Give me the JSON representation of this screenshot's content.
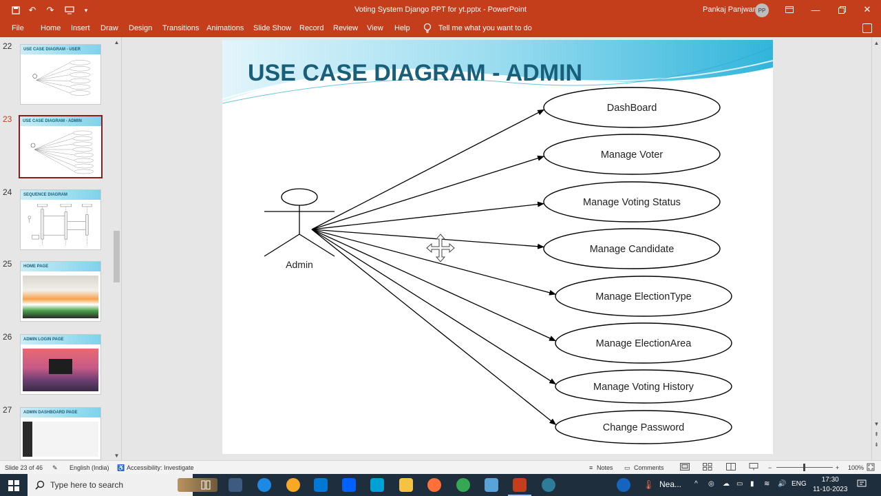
{
  "window": {
    "title": "Voting System Django PPT for yt.pptx  -  PowerPoint",
    "user_name": "Pankaj Panjwani",
    "user_initials": "PP",
    "qa_icons": [
      "save-icon",
      "undo-icon",
      "redo-icon",
      "touch-mode-icon",
      "customize-icon"
    ]
  },
  "ribbon": {
    "tabs": [
      "File",
      "Home",
      "Insert",
      "Draw",
      "Design",
      "Transitions",
      "Animations",
      "Slide Show",
      "Record",
      "Review",
      "View",
      "Help"
    ],
    "tell_me": "Tell me what you want to do"
  },
  "thumbnails": [
    {
      "num": "22",
      "title": "USE CASE DIAGRAM - USER",
      "selected": false
    },
    {
      "num": "23",
      "title": "USE CASE DIAGRAM - ADMIN",
      "selected": true
    },
    {
      "num": "24",
      "title": "SEQUENCE DIAGRAM",
      "selected": false
    },
    {
      "num": "25",
      "title": "HOME PAGE",
      "selected": false
    },
    {
      "num": "26",
      "title": "ADMIN LOGIN PAGE",
      "selected": false
    },
    {
      "num": "27",
      "title": "ADMIN DASHBOARD PAGE",
      "selected": false
    }
  ],
  "slide": {
    "title": "USE CASE DIAGRAM - ADMIN",
    "actor": "Admin",
    "use_cases": [
      "DashBoard",
      "Manage Voter",
      "Manage Voting Status",
      "Manage Candidate",
      "Manage ElectionType",
      "Manage ElectionArea",
      "Manage Voting History",
      "Change Password"
    ]
  },
  "status": {
    "slide_info": "Slide 23 of 46",
    "language": "English (India)",
    "accessibility": "Accessibility: Investigate",
    "notes": "Notes",
    "comments": "Comments",
    "zoom": "100%"
  },
  "taskbar": {
    "search_placeholder": "Type here to search",
    "weather": "Nea...",
    "language": "ENG",
    "time": "17:30",
    "date": "11-10-2023"
  },
  "colors": {
    "accent": "#c43e1c",
    "slide_title": "#1a5f7a",
    "selected_thumb_border": "#8b1a1a"
  }
}
